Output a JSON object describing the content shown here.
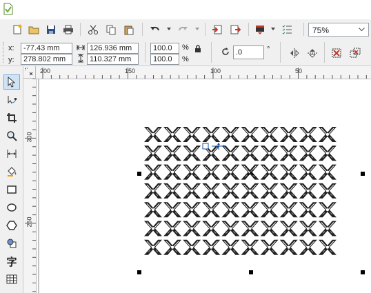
{
  "toolbar": {
    "zoom_value": "75%"
  },
  "property_bar": {
    "x_label": "x:",
    "x_value": "-77.43 mm",
    "y_label": "y:",
    "y_value": "278.802 mm",
    "width_value": "126.936 mm",
    "height_value": "110.327 mm",
    "scale_x": "100.0",
    "scale_y": "100.0",
    "percent_x": "%",
    "percent_y": "%",
    "rotation_value": ".0",
    "degree_symbol": "°"
  },
  "rulers": {
    "horizontal": [
      "200",
      "150",
      "100",
      "50"
    ],
    "vertical": [
      "300",
      "250"
    ]
  },
  "toolbox": {
    "text_tool_glyph": "字"
  }
}
